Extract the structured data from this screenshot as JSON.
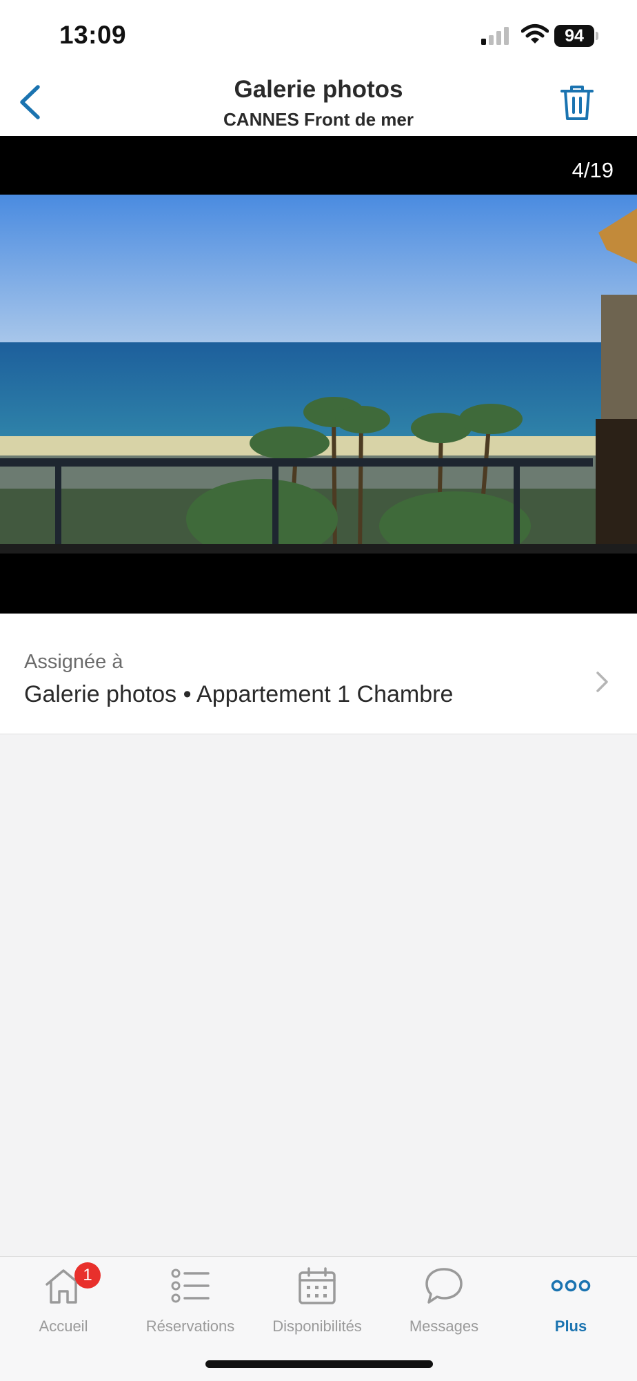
{
  "status_bar": {
    "time": "13:09",
    "battery": "94"
  },
  "header": {
    "title": "Galerie photos",
    "subtitle": "CANNES Front de mer"
  },
  "viewer": {
    "counter": "4/19"
  },
  "assignment": {
    "label": "Assignée à",
    "value": "Galerie photos • Appartement 1 Chambre"
  },
  "tabbar": {
    "items": [
      {
        "label": "Accueil",
        "icon": "home-icon",
        "badge": "1"
      },
      {
        "label": "Réservations",
        "icon": "list-icon"
      },
      {
        "label": "Disponibilités",
        "icon": "calendar-icon"
      },
      {
        "label": "Messages",
        "icon": "chat-bubble-icon"
      },
      {
        "label": "Plus",
        "icon": "more-dots-icon",
        "active": true
      }
    ]
  },
  "colors": {
    "accent": "#1a73b0",
    "badge": "#e8302c"
  }
}
